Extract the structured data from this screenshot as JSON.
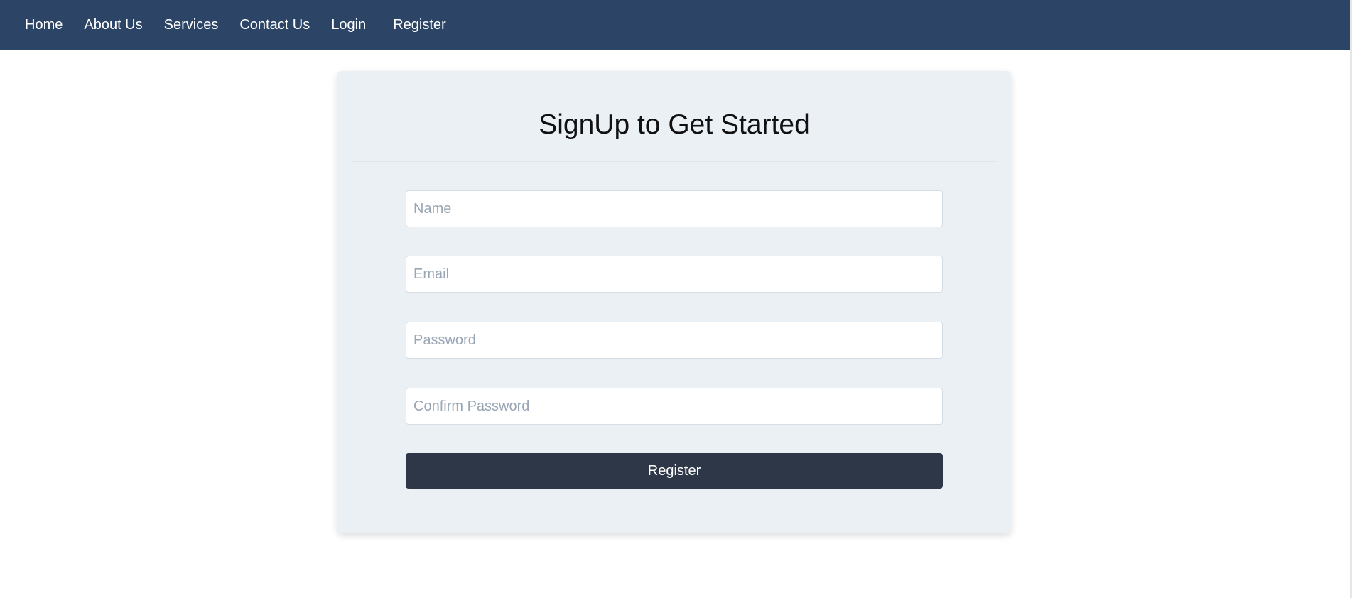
{
  "nav": {
    "items": [
      {
        "label": "Home"
      },
      {
        "label": "About Us"
      },
      {
        "label": "Services"
      },
      {
        "label": "Contact Us"
      },
      {
        "label": "Login"
      },
      {
        "label": "Register"
      }
    ]
  },
  "form": {
    "title": "SignUp to Get Started",
    "fields": {
      "name": {
        "placeholder": "Name",
        "value": ""
      },
      "email": {
        "placeholder": "Email",
        "value": ""
      },
      "password": {
        "placeholder": "Password",
        "value": ""
      },
      "confirm_password": {
        "placeholder": "Confirm Password",
        "value": ""
      }
    },
    "submit_label": "Register"
  },
  "colors": {
    "navbar": "#2c4566",
    "card": "#ebf0f5",
    "button": "#2d3748"
  }
}
